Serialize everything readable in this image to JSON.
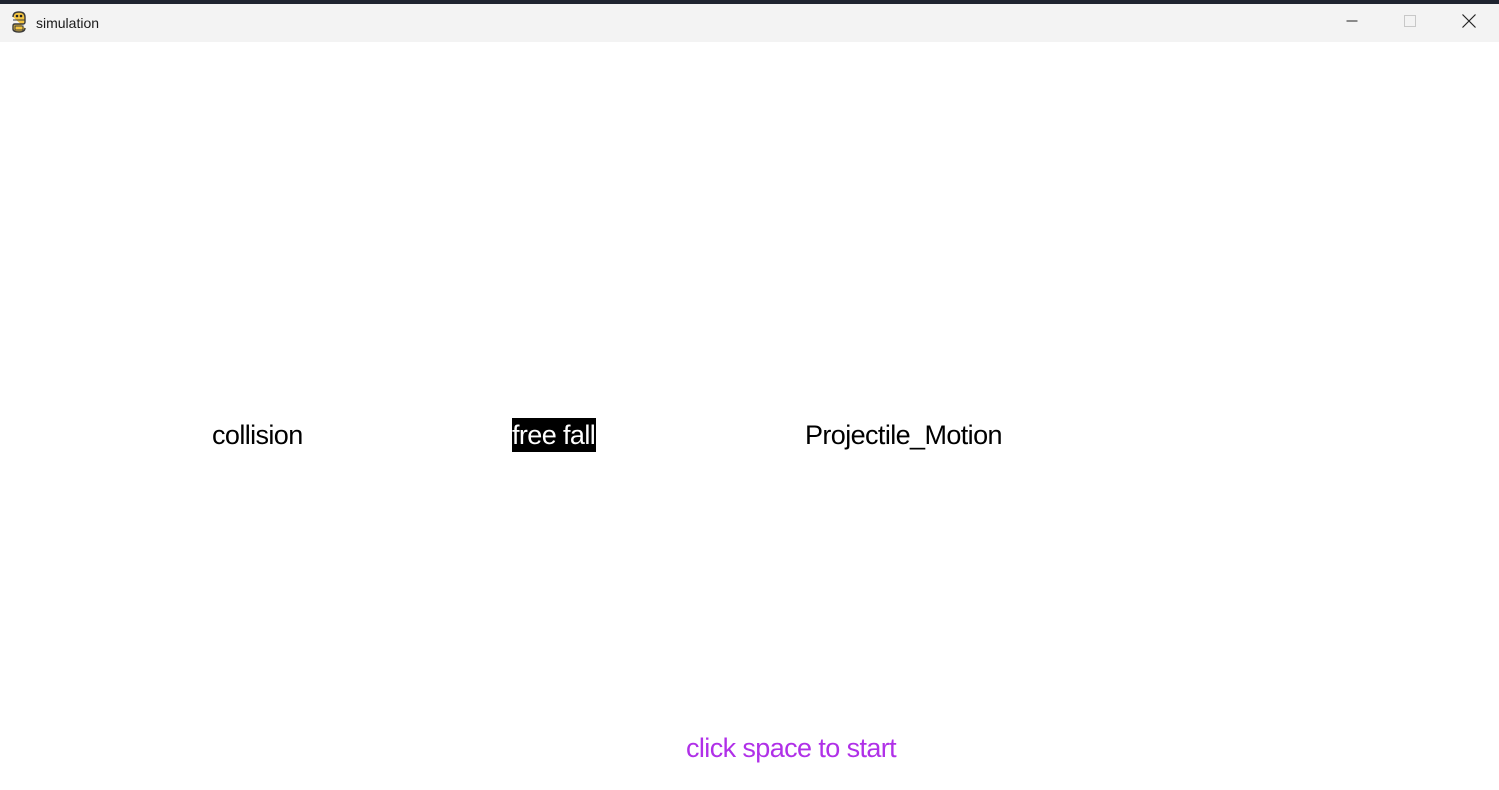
{
  "window": {
    "title": "simulation",
    "icon": "pygame-snake-icon",
    "controls": [
      "minimize-icon",
      "maximize-icon",
      "close-icon"
    ]
  },
  "menu": {
    "items": [
      {
        "label": "collision",
        "selected": false
      },
      {
        "label": "free fall",
        "selected": true
      },
      {
        "label": "Projectile_Motion",
        "selected": false
      }
    ]
  },
  "hint": {
    "text": "click space to start",
    "color": "#b030e8"
  },
  "colors": {
    "selected_bg": "#000000",
    "selected_fg": "#ffffff",
    "text": "#000000",
    "background": "#ffffff"
  }
}
